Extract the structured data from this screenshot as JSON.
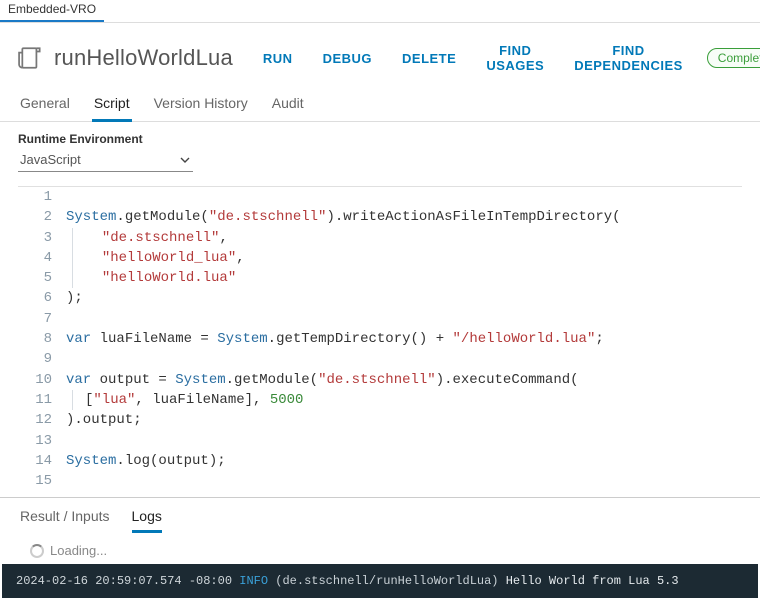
{
  "breadcrumb": "Embedded-VRO",
  "title": "runHelloWorldLua",
  "actions": {
    "run": "RUN",
    "debug": "DEBUG",
    "delete": "DELETE",
    "find_usages": "FIND USAGES",
    "find_deps": "FIND DEPENDENCIES"
  },
  "status": "Completed",
  "tabs": {
    "general": "General",
    "script": "Script",
    "version_history": "Version History",
    "audit": "Audit"
  },
  "runtime": {
    "label": "Runtime Environment",
    "value": "JavaScript"
  },
  "code": {
    "l1": "",
    "l2a": "System",
    "l2b": ".getModule(",
    "l2c": "\"de.stschnell\"",
    "l2d": ").writeActionAsFileInTempDirectory(",
    "l3": "\"de.stschnell\"",
    "l3e": ",",
    "l4": "\"helloWorld_lua\"",
    "l4e": ",",
    "l5": "\"helloWorld.lua\"",
    "l6": ");",
    "l7": "",
    "l8a": "var",
    "l8b": " luaFileName = ",
    "l8c": "System",
    "l8d": ".getTempDirectory() + ",
    "l8e": "\"/helloWorld.lua\"",
    "l8f": ";",
    "l9": "",
    "l10a": "var",
    "l10b": " output = ",
    "l10c": "System",
    "l10d": ".getModule(",
    "l10e": "\"de.stschnell\"",
    "l10f": ").executeCommand(",
    "l11a": "[",
    "l11b": "\"lua\"",
    "l11c": ", luaFileName], ",
    "l11d": "5000",
    "l12": ").output;",
    "l13": "",
    "l14a": "System",
    "l14b": ".log(output);",
    "l15": ""
  },
  "lines": {
    "n1": "1",
    "n2": "2",
    "n3": "3",
    "n4": "4",
    "n5": "5",
    "n6": "6",
    "n7": "7",
    "n8": "8",
    "n9": "9",
    "n10": "10",
    "n11": "11",
    "n12": "12",
    "n13": "13",
    "n14": "14",
    "n15": "15"
  },
  "bottom_tabs": {
    "result": "Result / Inputs",
    "logs": "Logs"
  },
  "loading": "Loading...",
  "log": {
    "ts": "2024-02-16 20:59:07.574 -08:00",
    "level": "INFO",
    "source": "(de.stschnell/runHelloWorldLua)",
    "msg": "Hello World from Lua 5.3"
  }
}
